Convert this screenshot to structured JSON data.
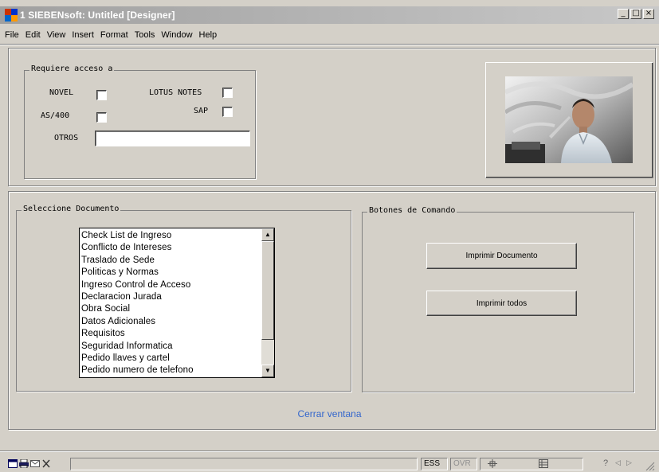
{
  "window": {
    "title": "1 SIEBENsoft: Untitled [Designer]",
    "controls": {
      "minimize": "_",
      "maximize": "□",
      "close": "×"
    }
  },
  "menu": [
    "File",
    "Edit",
    "View",
    "Insert",
    "Format",
    "Tools",
    "Window",
    "Help"
  ],
  "access_group": {
    "legend": "Requiere acceso a",
    "novel": "NOVEL",
    "lotus": "LOTUS NOTES",
    "as400": "AS/400",
    "sap": "SAP",
    "otros": "OTROS",
    "otros_value": ""
  },
  "document_group": {
    "legend": "Seleccione Documento",
    "items": [
      "Check List de Ingreso",
      "Conflicto de Intereses",
      "Traslado de Sede",
      "Politicas y Normas",
      "Ingreso Control de Acceso",
      "Declaracion Jurada",
      "Obra Social",
      "Datos Adicionales",
      "Requisitos",
      "Seguridad Informatica",
      "Pedido llaves y cartel",
      "Pedido numero de telefono"
    ]
  },
  "commands_group": {
    "legend": "Botones de Comando",
    "print_document": "Imprimir Documento",
    "print_all": "Imprimir todos"
  },
  "close_link": "Cerrar ventana",
  "status": {
    "ess": "ESS",
    "ovr": "OVR",
    "help": "?"
  },
  "icons": {
    "scroll_up": "chevron-up-icon",
    "scroll_down": "chevron-down-icon",
    "photo": "profile-photo"
  },
  "colors": {
    "face": "#d4d0c8",
    "titlebar": "#a0a0a0",
    "link": "#3366cc"
  }
}
